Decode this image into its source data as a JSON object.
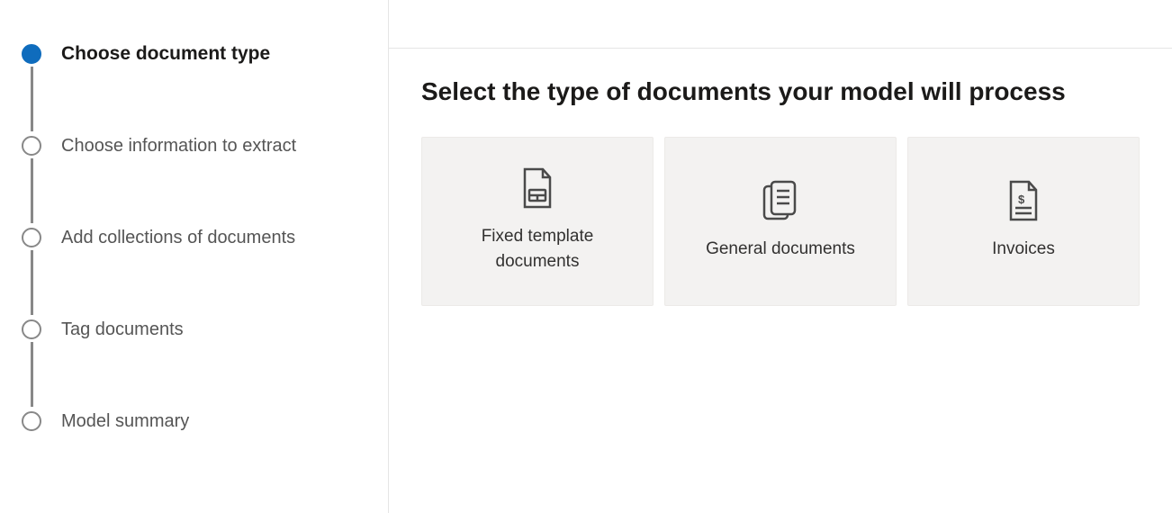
{
  "sidebar": {
    "steps": [
      {
        "label": "Choose document type",
        "active": true
      },
      {
        "label": "Choose information to extract",
        "active": false
      },
      {
        "label": "Add collections of documents",
        "active": false
      },
      {
        "label": "Tag documents",
        "active": false
      },
      {
        "label": "Model summary",
        "active": false
      }
    ]
  },
  "main": {
    "title": "Select the type of documents your model will process",
    "cards": [
      {
        "label": "Fixed template documents",
        "icon": "template-document-icon"
      },
      {
        "label": "General documents",
        "icon": "general-document-icon"
      },
      {
        "label": "Invoices",
        "icon": "invoice-document-icon"
      }
    ]
  }
}
